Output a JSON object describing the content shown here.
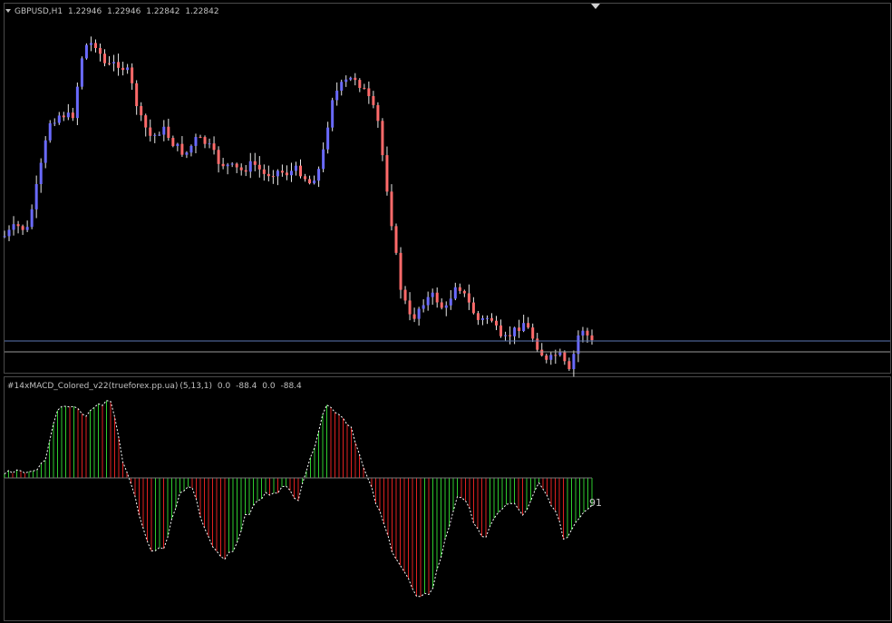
{
  "main_header": {
    "symbol": "GBPUSD,H1",
    "open": "1.22946",
    "high": "1.22946",
    "low": "1.22842",
    "close": "1.22842"
  },
  "sub_header": {
    "indicator": "#14xMACD_Colored_v22(trueforex.pp.ua)",
    "params": "(5,13,1)",
    "v1": "0.0",
    "v2": "-88.4",
    "v3": "0.0",
    "v4": "-88.4"
  },
  "value_label": "91",
  "colors": {
    "background": "#000000",
    "bull_candle": "#6a6aff",
    "bear_candle": "#ff6a6a",
    "histo_up": "#2ecc2e",
    "histo_down": "#e02020",
    "signal_line": "#ffffff",
    "level_line": "#5b78b5"
  },
  "chart_data": {
    "type": "candlestick",
    "price_line": [
      0.02,
      0.07,
      0.05,
      0.3,
      0.58,
      0.62,
      0.6,
      0.95,
      0.97,
      0.85,
      0.87,
      0.82,
      0.6,
      0.5,
      0.55,
      0.47,
      0.42,
      0.5,
      0.47,
      0.38,
      0.36,
      0.34,
      0.38,
      0.32,
      0.34,
      0.33,
      0.35,
      0.28,
      0.36,
      0.7,
      0.77,
      0.8,
      0.72,
      0.6,
      0.2,
      -0.22,
      -0.4,
      -0.3,
      -0.27,
      -0.35,
      -0.2,
      -0.3,
      -0.4,
      -0.37,
      -0.5,
      -0.45,
      -0.4,
      -0.5,
      -0.6,
      -0.55,
      -0.65,
      -0.42,
      -0.5
    ],
    "macd": [
      0.05,
      0.1,
      0.05,
      0.2,
      0.85,
      0.88,
      0.75,
      0.88,
      0.92,
      0.1,
      -0.25,
      -0.6,
      -0.55,
      -0.15,
      -0.05,
      -0.4,
      -0.6,
      -0.62,
      -0.32,
      -0.18,
      -0.1,
      -0.08,
      -0.15,
      0.25,
      0.88,
      0.78,
      0.6,
      0.05,
      -0.25,
      -0.55,
      -0.75,
      -0.98,
      -0.88,
      -0.5,
      -0.1,
      -0.3,
      -0.5,
      -0.25,
      -0.2,
      -0.3,
      -0.05,
      -0.2,
      -0.5,
      -0.3,
      -0.2
    ]
  }
}
